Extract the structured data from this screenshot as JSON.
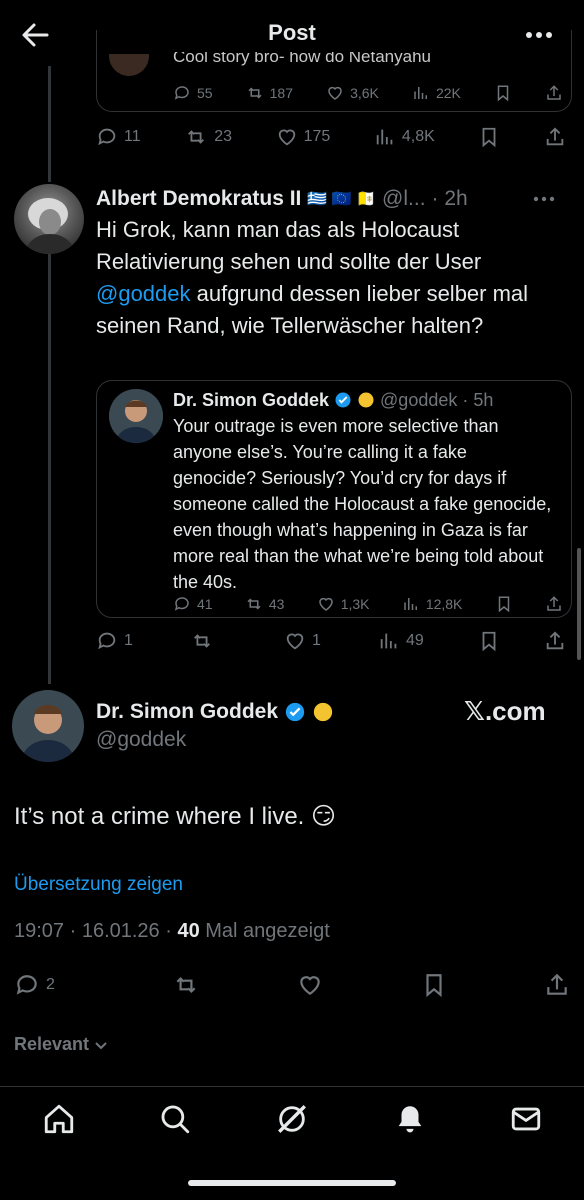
{
  "header": {
    "title": "Post"
  },
  "top_quote": {
    "partial_text": "Cool story bro- how do Netanyahu",
    "replies": "55",
    "reposts": "187",
    "likes": "3,6K",
    "views": "22K"
  },
  "top_post_actions": {
    "replies": "11",
    "reposts": "23",
    "likes": "175",
    "views": "4,8K"
  },
  "reply": {
    "name": "Albert Demokratus II",
    "flags": "🇬🇷 🇪🇺 🇻🇦",
    "handle": "@l...",
    "time": "· 2h",
    "text_part1": "Hi Grok, kann man das als Holocaust Relativierung sehen und sollte der User ",
    "mention": "@goddek",
    "text_part2": " aufgrund dessen lieber selber mal seinen Rand, wie Tellerwäscher halten?",
    "quote": {
      "name": "Dr. Simon Goddek",
      "handle": "@goddek",
      "time": "· 5h",
      "text": "Your outrage is even more selective than anyone else’s. You’re calling it a fake genocide? Seriously? You’d cry for days if someone called the Holocaust a fake genocide, even though what’s happening in Gaza is far more real than the what we’re being told about the 40s.",
      "replies": "41",
      "reposts": "43",
      "likes": "1,3K",
      "views": "12,8K"
    },
    "actions": {
      "replies": "1",
      "reposts": "",
      "likes": "1",
      "views": "49"
    }
  },
  "main": {
    "name": "Dr. Simon Goddek",
    "handle": "@goddek",
    "source": "𝕏.com",
    "text": "It’s not a crime where I live. 😏",
    "translate": "Übersetzung zeigen",
    "time_date": "19:07 · 16.01.26 · ",
    "views_count": "40",
    "views_label": " Mal angezeigt",
    "actions": {
      "replies": "2"
    },
    "sort_label": "Relevant"
  },
  "colors": {
    "accent": "#1d9bf0",
    "background": "#000000",
    "muted": "#71767b",
    "verified": "#1d9bf0",
    "gold": "#f4c430"
  },
  "nav_icons": [
    "home-icon",
    "search-icon",
    "grok-icon",
    "notifications-icon",
    "messages-icon"
  ]
}
